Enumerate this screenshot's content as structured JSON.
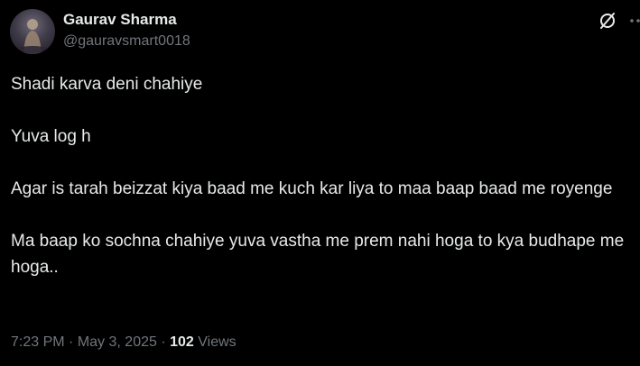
{
  "author": {
    "display_name": "Gaurav Sharma",
    "handle": "@gauravsmart0018"
  },
  "icons": {
    "grok": "grok-icon",
    "more": "more-horizontal-icon"
  },
  "tweet": {
    "paragraphs": [
      "Shadi karva deni chahiye",
      "Yuva log h",
      "Agar is tarah beizzat kiya baad me kuch kar liya to maa baap baad me royenge",
      "Ma baap ko sochna chahiye yuva vastha me prem nahi hoga to kya budhape me hoga.."
    ]
  },
  "meta": {
    "time": "7:23 PM",
    "separator": "·",
    "date": "May 3, 2025",
    "views_count": "102",
    "views_label": "Views"
  },
  "colors": {
    "background": "#000000",
    "primary_text": "#e7e9ea",
    "secondary_text": "#71767b"
  }
}
